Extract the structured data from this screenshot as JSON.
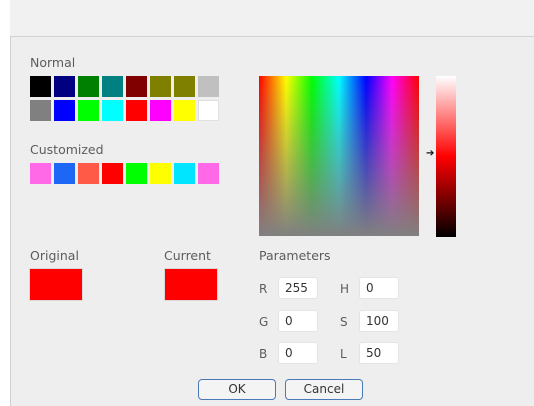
{
  "labels": {
    "normal": "Normal",
    "customized": "Customized",
    "original": "Original",
    "current": "Current",
    "parameters": "Parameters"
  },
  "normal_colors": [
    "#000000",
    "#000080",
    "#008000",
    "#008080",
    "#800000",
    "#808000",
    "#808000",
    "#c0c0c0",
    "#808080",
    "#0000ff",
    "#00ff00",
    "#00ffff",
    "#ff0000",
    "#ff00ff",
    "#ffff00",
    "#ffffff"
  ],
  "customized_colors": [
    "#ff69e8",
    "#1e66f5",
    "#ff5a47",
    "#ff0000",
    "#00ff00",
    "#ffff00",
    "#00e5ff",
    "#ff69e8"
  ],
  "original_color": "#ff0000",
  "current_color": "#ff0000",
  "params": {
    "r": {
      "label": "R",
      "value": "255"
    },
    "g": {
      "label": "G",
      "value": "0"
    },
    "b": {
      "label": "B",
      "value": "0"
    },
    "h": {
      "label": "H",
      "value": "0"
    },
    "s": {
      "label": "S",
      "value": "100"
    },
    "l": {
      "label": "L",
      "value": "50"
    }
  },
  "buttons": {
    "ok": "OK",
    "cancel": "Cancel"
  },
  "icons": {
    "luminance_pointer": "arrow-right-icon"
  }
}
